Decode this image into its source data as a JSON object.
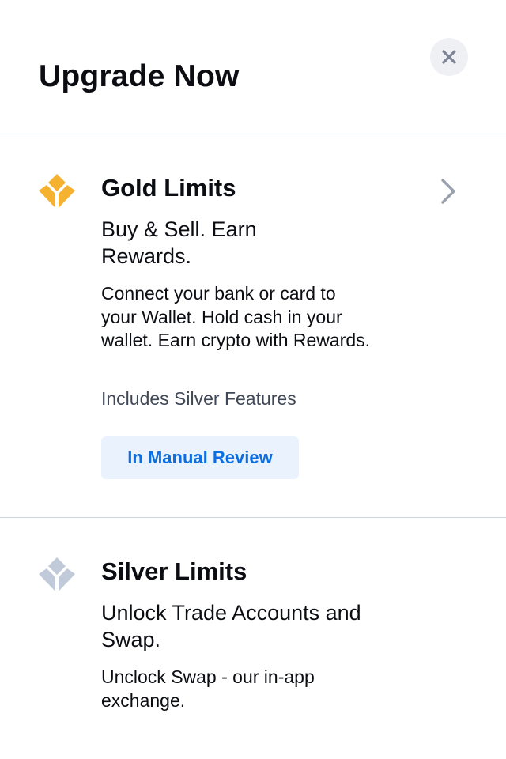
{
  "header": {
    "title": "Upgrade Now",
    "close_icon": "close-icon"
  },
  "tiers": [
    {
      "name": "Gold Limits",
      "icon": "gold-tier-icon",
      "icon_color": "#F5B231",
      "tagline": "Buy & Sell. Earn Rewards.",
      "description": "Connect your bank or card to your Wallet. Hold cash in your wallet. Earn crypto with Rewards.",
      "includes": "Includes Silver Features",
      "status": "In Manual Review",
      "has_chevron": true
    },
    {
      "name": "Silver Limits",
      "icon": "silver-tier-icon",
      "icon_color": "#C1CAD8",
      "tagline": "Unlock Trade Accounts and Swap.",
      "description": "Unclock Swap - our in-app exchange."
    }
  ],
  "colors": {
    "status_text": "#0D6EE1",
    "status_background": "#EAF3FD",
    "close_button_background": "#EEF0F4",
    "chevron": "#99A0AE"
  }
}
